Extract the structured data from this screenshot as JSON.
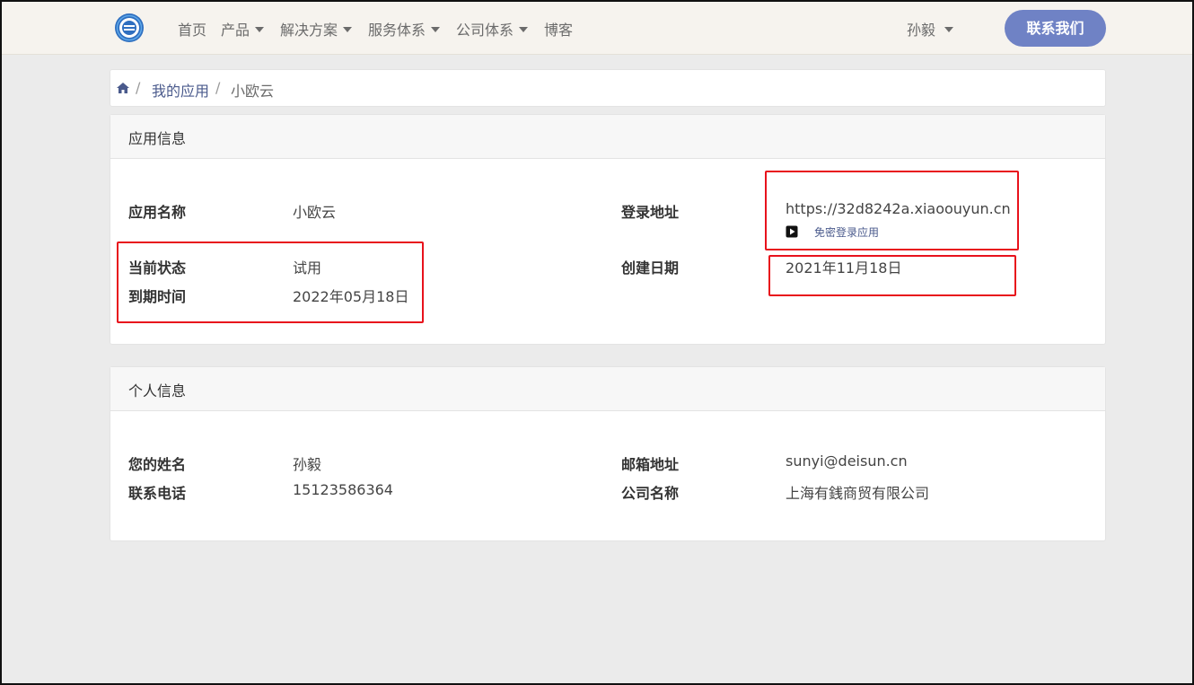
{
  "nav": {
    "items": [
      {
        "label": "首页",
        "has_caret": false
      },
      {
        "label": "产品",
        "has_caret": true
      },
      {
        "label": "解决方案",
        "has_caret": true
      },
      {
        "label": "服务体系",
        "has_caret": true
      },
      {
        "label": "公司体系",
        "has_caret": true
      },
      {
        "label": "博客",
        "has_caret": false
      }
    ],
    "user": "孙毅",
    "contact_button": "联系我们"
  },
  "breadcrumb": {
    "sep1": "/",
    "link": "我的应用",
    "sep2": "/",
    "current": "小欧云"
  },
  "app_info": {
    "title": "应用信息",
    "name_label": "应用名称",
    "name_value": "小欧云",
    "status_label": "当前状态",
    "status_value": "试用",
    "expire_label": "到期时间",
    "expire_value": "2022年05月18日",
    "login_label": "登录地址",
    "login_url": "https://32d8242a.xiaoouyun.cn",
    "login_button": "免密登录应用",
    "created_label": "创建日期",
    "created_value": "2021年11月18日"
  },
  "personal_info": {
    "title": "个人信息",
    "name_label": "您的姓名",
    "name_value": "孙毅",
    "phone_label": "联系电话",
    "phone_value": "15123586364",
    "email_label": "邮箱地址",
    "email_value": "sunyi@deisun.cn",
    "company_label": "公司名称",
    "company_value": "上海有銭商贸有限公司"
  },
  "colors": {
    "accent": "#6f82c5",
    "highlight": "#e8121c",
    "navbar_bg": "#f6f3ee",
    "page_bg": "#ebebeb"
  }
}
